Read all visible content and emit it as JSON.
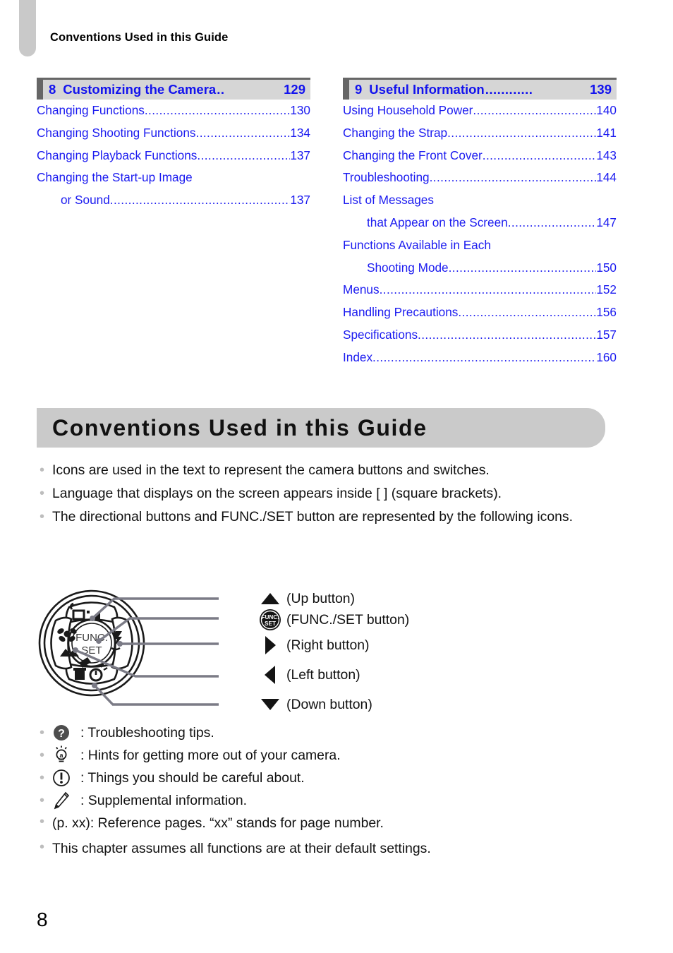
{
  "page": {
    "running_header": "Conventions Used in this Guide",
    "page_number": "8"
  },
  "toc": {
    "columns": [
      {
        "header": {
          "number": "8",
          "title": "Customizing the Camera",
          "leader": "..",
          "page": "129"
        },
        "entries": [
          {
            "label": "Changing Functions",
            "page": "130",
            "indent": false,
            "leader": true
          },
          {
            "label": "Changing Shooting Functions",
            "page": "134",
            "indent": false,
            "leader": true
          },
          {
            "label": "Changing Playback Functions",
            "page": "137",
            "indent": false,
            "leader": true
          },
          {
            "label": "Changing the Start-up Image",
            "page": "",
            "indent": false,
            "leader": false
          },
          {
            "label": "or Sound",
            "page": "137",
            "indent": true,
            "leader": true
          }
        ]
      },
      {
        "header": {
          "number": "9",
          "title": "Useful Information",
          "leader": "............",
          "page": "139"
        },
        "entries": [
          {
            "label": "Using Household Power",
            "page": "140",
            "indent": false,
            "leader": true
          },
          {
            "label": "Changing the Strap",
            "page": "141",
            "indent": false,
            "leader": true
          },
          {
            "label": "Changing the Front Cover",
            "page": "143",
            "indent": false,
            "leader": true
          },
          {
            "label": "Troubleshooting",
            "page": "144",
            "indent": false,
            "leader": true
          },
          {
            "label": "List of Messages",
            "page": "",
            "indent": false,
            "leader": false
          },
          {
            "label": "that Appear on the Screen",
            "page": "147",
            "indent": true,
            "leader": true
          },
          {
            "label": "Functions Available in Each",
            "page": "",
            "indent": false,
            "leader": false
          },
          {
            "label": "Shooting Mode",
            "page": "150",
            "indent": true,
            "leader": true
          },
          {
            "label": "Menus",
            "page": "152",
            "indent": false,
            "leader": true
          },
          {
            "label": "Handling Precautions",
            "page": "156",
            "indent": false,
            "leader": true
          },
          {
            "label": "Specifications",
            "page": "157",
            "indent": false,
            "leader": true
          },
          {
            "label": "Index",
            "page": "160",
            "indent": false,
            "leader": true
          }
        ]
      }
    ]
  },
  "chapter": {
    "banner_title": "Conventions Used in this Guide"
  },
  "intro_bullets": [
    "Icons are used in the text to represent the camera buttons and switches.",
    "Language that displays on the screen appears inside [ ] (square brackets).",
    "The directional buttons and FUNC./SET button are represented by the following icons."
  ],
  "figure": {
    "dial_alt": "camera-control-dial",
    "callouts": [
      {
        "icon": "up-triangle-icon",
        "text": "(Up button)"
      },
      {
        "icon": "func-set-icon",
        "text": "(FUNC./SET button)"
      },
      {
        "icon": "right-triangle-icon",
        "text": "(Right button)"
      },
      {
        "icon": "left-triangle-icon",
        "text": "(Left button)"
      },
      {
        "icon": "down-triangle-icon",
        "text": "(Down button)"
      }
    ]
  },
  "legend_bullets": [
    {
      "icon": "question-mark-icon",
      "text": ": Troubleshooting tips."
    },
    {
      "icon": "lightbulb-icon",
      "text": ": Hints for getting more out of your camera."
    },
    {
      "icon": "exclamation-circle-icon",
      "text": ": Things you should be careful about."
    },
    {
      "icon": "pencil-icon",
      "text": ": Supplemental information."
    }
  ],
  "closing_bullets": [
    "(p. xx): Reference pages. “xx” stands for page number.",
    "This chapter assumes all functions are at their default settings."
  ],
  "colors": {
    "toc_link": "#1b1bf0",
    "toc_header_bg": "#d6d6d6",
    "toc_header_rule": "#666666",
    "banner_bg": "#cacaca",
    "tab_gray": "#c9c9c9",
    "bullet_gray": "#bdbdbd"
  },
  "bullet_glyph": "•"
}
